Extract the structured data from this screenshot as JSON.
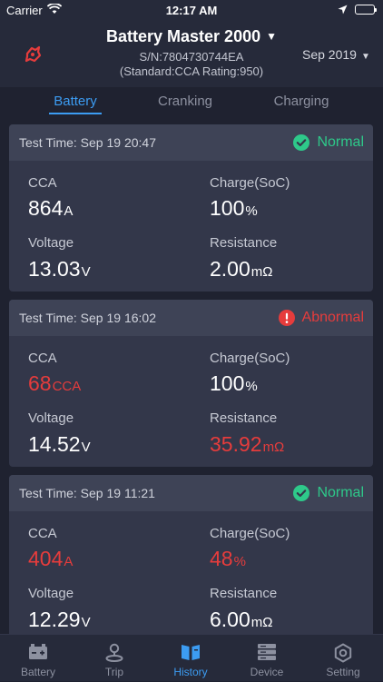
{
  "status_bar": {
    "carrier": "Carrier",
    "time": "12:17 AM"
  },
  "header": {
    "device_name": "Battery Master 2000",
    "serial": "S/N:7804730744EA",
    "spec": "(Standard:CCA  Rating:950)",
    "month": "Sep 2019",
    "logo_icon": "battery-brand-icon"
  },
  "tabs": [
    {
      "label": "Battery",
      "active": true
    },
    {
      "label": "Cranking",
      "active": false
    },
    {
      "label": "Charging",
      "active": false
    }
  ],
  "records": [
    {
      "test_time": "Test Time: Sep 19 20:47",
      "status": "Normal",
      "cca_label": "CCA",
      "cca_value": "864",
      "cca_unit": "A",
      "charge_label": "Charge(SoC)",
      "charge_value": "100",
      "charge_unit": "%",
      "voltage_label": "Voltage",
      "voltage_value": "13.03",
      "voltage_unit": "V",
      "resistance_label": "Resistance",
      "resistance_value": "2.00",
      "resistance_unit": "mΩ"
    },
    {
      "test_time": "Test Time: Sep 19 16:02",
      "status": "Abnormal",
      "cca_label": "CCA",
      "cca_value": "68",
      "cca_unit": "CCA",
      "charge_label": "Charge(SoC)",
      "charge_value": "100",
      "charge_unit": "%",
      "voltage_label": "Voltage",
      "voltage_value": "14.52",
      "voltage_unit": "V",
      "resistance_label": "Resistance",
      "resistance_value": "35.92",
      "resistance_unit": "mΩ"
    },
    {
      "test_time": "Test Time: Sep 19 11:21",
      "status": "Normal",
      "cca_label": "CCA",
      "cca_value": "404",
      "cca_unit": "A",
      "charge_label": "Charge(SoC)",
      "charge_value": "48",
      "charge_unit": "%",
      "voltage_label": "Voltage",
      "voltage_value": "12.29",
      "voltage_unit": "V",
      "resistance_label": "Resistance",
      "resistance_value": "6.00",
      "resistance_unit": "mΩ"
    }
  ],
  "colors": {
    "accent": "#3c9cf2",
    "ok": "#2ec98a",
    "error": "#e63c3c",
    "background": "#1f2230",
    "card": "#33374a"
  },
  "tabbar": [
    {
      "label": "Battery",
      "icon": "battery-icon",
      "active": false
    },
    {
      "label": "Trip",
      "icon": "trip-pin-icon",
      "active": false
    },
    {
      "label": "History",
      "icon": "history-book-icon",
      "active": true
    },
    {
      "label": "Device",
      "icon": "device-server-icon",
      "active": false
    },
    {
      "label": "Setting",
      "icon": "gear-icon",
      "active": false
    }
  ]
}
